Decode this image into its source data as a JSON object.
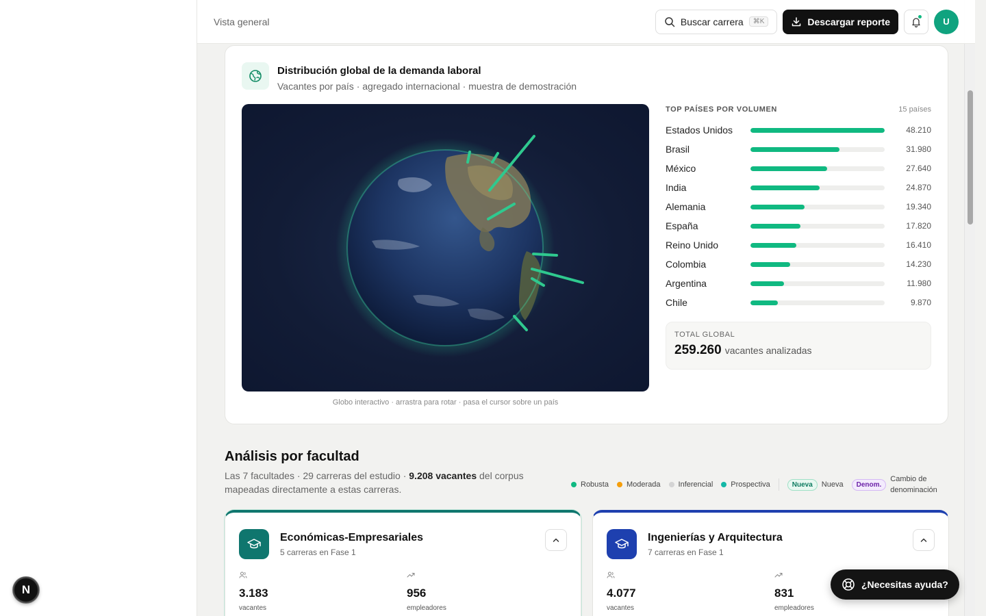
{
  "header": {
    "breadcrumb": "Vista general",
    "search_label": "Buscar carrera",
    "search_shortcut": "⌘K",
    "download_label": "Descargar reporte",
    "avatar_initial": "U"
  },
  "globe_card": {
    "title": "Distribución global de la demanda laboral",
    "subtitle": "Vacantes por país · agregado internacional · muestra de demostración",
    "caption": "Globo interactivo · arrastra para rotar · pasa el cursor sobre un país",
    "top_title": "TOP PAÍSES POR VOLUMEN",
    "top_count": "15 países",
    "countries": [
      {
        "name": "Estados Unidos",
        "value": "48.210",
        "share": 1.0
      },
      {
        "name": "Brasil",
        "value": "31.980",
        "share": 0.663
      },
      {
        "name": "México",
        "value": "27.640",
        "share": 0.573
      },
      {
        "name": "India",
        "value": "24.870",
        "share": 0.516
      },
      {
        "name": "Alemania",
        "value": "19.340",
        "share": 0.401
      },
      {
        "name": "España",
        "value": "17.820",
        "share": 0.37
      },
      {
        "name": "Reino Unido",
        "value": "16.410",
        "share": 0.34
      },
      {
        "name": "Colombia",
        "value": "14.230",
        "share": 0.295
      },
      {
        "name": "Argentina",
        "value": "11.980",
        "share": 0.248
      },
      {
        "name": "Chile",
        "value": "9.870",
        "share": 0.205
      }
    ],
    "total_label": "TOTAL GLOBAL",
    "total_value": "259.260",
    "total_unit": "vacantes analizadas"
  },
  "faculty_section": {
    "title": "Análisis por facultad",
    "desc_a": "Las 7 facultades · 29 carreras del estudio · ",
    "desc_b": "9.208 vacantes",
    "desc_c": " del corpus mapeadas directamente a estas carreras.",
    "legend": {
      "robusta": "Robusta",
      "moderada": "Moderada",
      "inferencial": "Inferencial",
      "prospectiva": "Prospectiva",
      "pill_new": "Nueva",
      "new_label": "Nueva",
      "pill_den": "Denom.",
      "den_label": "Cambio de denominación"
    },
    "colors": {
      "robusta": "#10b981",
      "moderada": "#f59e0b",
      "inferencial": "#d4d4d4",
      "prospectiva": "#14b8a6"
    },
    "faculties": [
      {
        "name": "Económicas-Empresariales",
        "sub": "5 carreras en Fase 1",
        "vacantes": "3.183",
        "vacantes_label": "vacantes",
        "empleadores": "956",
        "empleadores_label": "empleadores",
        "accent": "#0f766e"
      },
      {
        "name": "Ingenierías y Arquitectura",
        "sub": "7 carreras en Fase 1",
        "vacantes": "4.077",
        "vacantes_label": "vacantes",
        "empleadores": "831",
        "empleadores_label": "empleadores",
        "accent": "#1e40af"
      }
    ]
  },
  "help": {
    "label": "¿Necesitas ayuda?"
  },
  "dev_badge": {
    "letter": "N"
  }
}
